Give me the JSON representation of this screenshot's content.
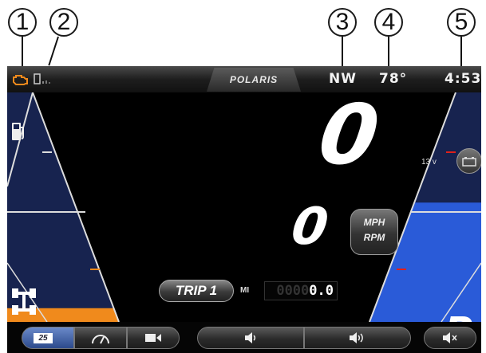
{
  "callouts": {
    "c1": "1",
    "c2": "2",
    "c3": "3",
    "c4": "4",
    "c5": "5"
  },
  "topbar": {
    "brand": "POLARIS",
    "heading": "NW",
    "temperature": "78°",
    "time": "4:53"
  },
  "icons": {
    "check_engine": "engine-warning-icon",
    "signal": "cell-signal-icon",
    "fuel": "fuel-pump-icon",
    "awd": "awd-drivetrain-icon",
    "battery": "battery-icon",
    "gauge": "gauge-icon",
    "camera": "camera-icon",
    "volume_down": "volume-down-icon",
    "volume_up": "volume-up-icon",
    "mute": "mute-icon"
  },
  "gauges": {
    "fuel_level": 0.06,
    "battery_level": 0.52
  },
  "main": {
    "speed": "0",
    "rpm": "0",
    "unit_primary": "MPH",
    "unit_secondary": "RPM",
    "trip_label": "TRIP 1",
    "odometer_unit": "MI",
    "odometer_dim": "0000",
    "odometer_value": "0.0",
    "voltage": "13 v",
    "gear": "P"
  },
  "bottombar": {
    "speed_limit_value": "25"
  },
  "colors": {
    "accent_orange": "#f08a1c",
    "accent_red": "#e0201a",
    "gauge_blue": "#2a5bd8",
    "gauge_dark_blue": "#17234f"
  }
}
